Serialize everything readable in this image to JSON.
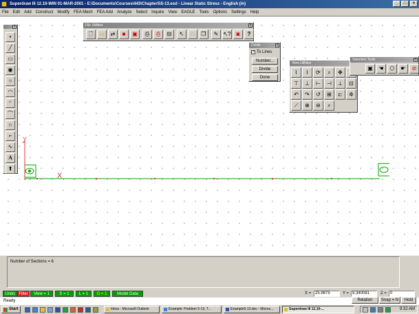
{
  "window": {
    "title": "Superdraw III 12.10-WIN 01-MAR-2001 - E:\\Documents\\Courses\\443\\Chapter5\\5-13.esd - Linear Static Stress - English (in)"
  },
  "menu": [
    "File",
    "Edit",
    "Add",
    "Construct",
    "Modify",
    "FEA Mesh",
    "FEA Add",
    "Analyze",
    "Select",
    "Inquire",
    "View",
    "EAGLE",
    "Tools",
    "Options",
    "Settings",
    "Help"
  ],
  "file_utilities": {
    "title": "File Utilities",
    "close": "x",
    "buttons": [
      "new-file-icon",
      "open-folder-icon",
      "transfer-icon",
      "save-icon",
      "save-as-icon",
      "print-icon",
      "print-setup-icon",
      "plot-icon",
      "pointer-icon",
      "blank-icon",
      "copy-icon",
      "pen-icon",
      "help-query-icon",
      "display-icon",
      "help-icon"
    ]
  },
  "divide": {
    "title": "Divide",
    "close": "x",
    "checkbox_label": "To Lines",
    "checked": true,
    "buttons": {
      "number": "Number...",
      "divide": "Divide",
      "done": "Done"
    }
  },
  "view_utilities": {
    "title": "View Utilities",
    "close": "x"
  },
  "selection_tools": {
    "title": "Selection Tools",
    "close": "x"
  },
  "left_toolbar": {
    "text_tool": "A"
  },
  "canvas": {
    "axis_label": "Y",
    "origin_marker": "X"
  },
  "message": {
    "text": "Number of Sections = 6"
  },
  "status": {
    "modes": [
      {
        "label": "Undo",
        "bg": "#00a000",
        "fg": "#ffffff"
      },
      {
        "label": "Filter",
        "bg": "#e02020",
        "fg": "#ffffff"
      },
      {
        "label": "View = 1",
        "bg": "#00a000",
        "fg": "#ffffff"
      },
      {
        "label": "S = 1",
        "bg": "#00a000",
        "fg": "#ffffff"
      },
      {
        "label": "L = 1",
        "bg": "#00a000",
        "fg": "#ffffff"
      },
      {
        "label": "G = 1",
        "bg": "#00a000",
        "fg": "#ffff00"
      },
      {
        "label": "Model Data",
        "bg": "#00a000",
        "fg": "#ffffff"
      }
    ],
    "x_label": "X =",
    "x_value": "25.9875",
    "y_label": "Y =",
    "y_value": "9.340081",
    "z_label": "Z =",
    "z_value": "0",
    "relation": "Relation",
    "snap": "Snap = N",
    "hold": "Hold",
    "ready": "Ready"
  },
  "taskbar": {
    "start": "Start",
    "tasks": [
      {
        "label": "Inbox - Microsoft Outlook",
        "active": false
      },
      {
        "label": "Example: Problem 5-13, T...",
        "active": false
      },
      {
        "label": "Example5-13.doc - Micros...",
        "active": false
      },
      {
        "label": "Superdraw III 12.10-...",
        "active": true
      }
    ],
    "clock": "9:32 AM"
  }
}
